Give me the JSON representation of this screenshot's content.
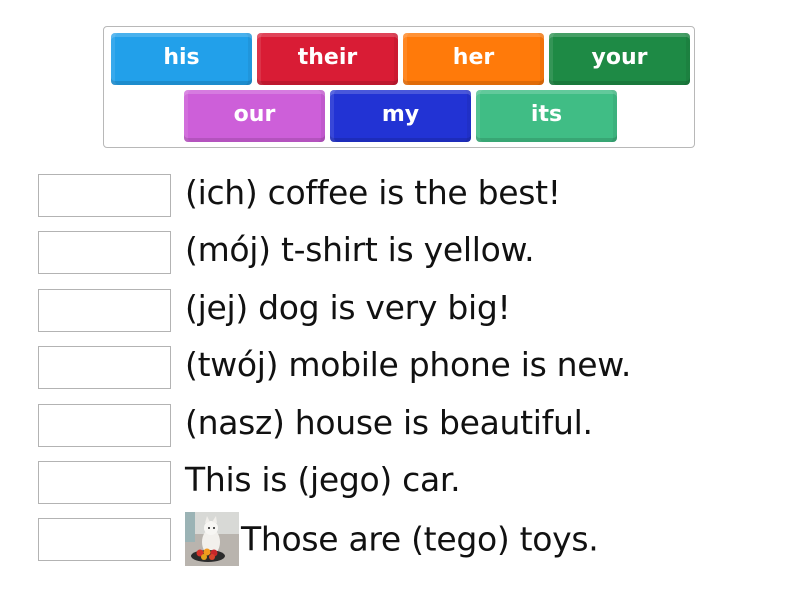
{
  "word_bank": {
    "tiles": [
      {
        "label": "his",
        "color": "#22a0ea"
      },
      {
        "label": "their",
        "color": "#d91c35"
      },
      {
        "label": "her",
        "color": "#ff7a0a"
      },
      {
        "label": "your",
        "color": "#1e8a45"
      },
      {
        "label": "our",
        "color": "#cd5fd9"
      },
      {
        "label": "my",
        "color": "#2233d4"
      },
      {
        "label": "its",
        "color": "#40bd85"
      }
    ]
  },
  "sentences": [
    {
      "text": "(ich) coffee is the best!",
      "answer": ""
    },
    {
      "text": "(mój) t-shirt is yellow.",
      "answer": ""
    },
    {
      "text": "(jej) dog is very big!",
      "answer": ""
    },
    {
      "text": "(twój) mobile phone is new.",
      "answer": ""
    },
    {
      "text": "(nasz) house is beautiful.",
      "answer": ""
    },
    {
      "text": "This is (jego) car.",
      "answer": ""
    },
    {
      "text": "Those are (tego) toys.",
      "answer": "",
      "image": "dog-with-toy-bowl"
    }
  ]
}
